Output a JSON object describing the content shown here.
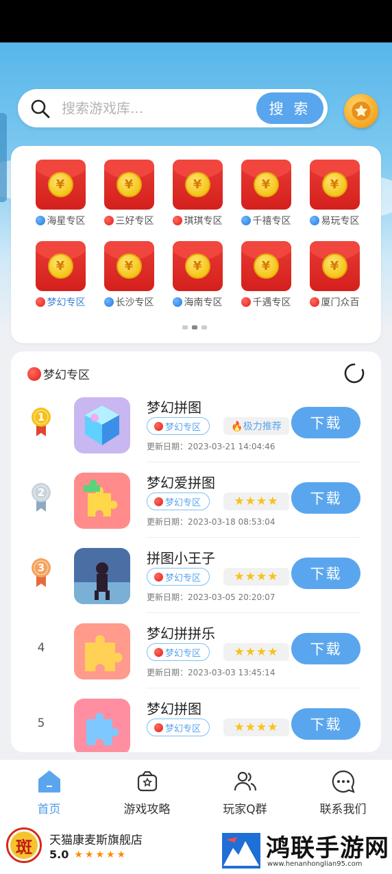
{
  "search": {
    "placeholder": "搜索游戏库...",
    "button_label": "搜 索"
  },
  "zones": [
    {
      "label": "海星专区",
      "dot": "blue",
      "active": false
    },
    {
      "label": "三好专区",
      "dot": "red",
      "active": false
    },
    {
      "label": "琪琪专区",
      "dot": "red",
      "active": false
    },
    {
      "label": "千禧专区",
      "dot": "blue",
      "active": false
    },
    {
      "label": "易玩专区",
      "dot": "blue",
      "active": false
    },
    {
      "label": "梦幻专区",
      "dot": "red",
      "active": true
    },
    {
      "label": "长沙专区",
      "dot": "blue",
      "active": false
    },
    {
      "label": "海南专区",
      "dot": "blue",
      "active": false
    },
    {
      "label": "千遇专区",
      "dot": "red",
      "active": false
    },
    {
      "label": "厦门众百",
      "dot": "red",
      "active": false
    }
  ],
  "coin_symbol": "¥",
  "list": {
    "header": "梦幻专区",
    "games": [
      {
        "rank": "1",
        "title": "梦幻拼图",
        "zone_tag": "梦幻专区",
        "extra_tag": "🔥极力推荐",
        "extra_type": "recommend",
        "update": "更新日期：2023-03-21 14:04:46",
        "button": "下载"
      },
      {
        "rank": "2",
        "title": "梦幻爱拼图",
        "zone_tag": "梦幻专区",
        "extra_tag": "★★★★",
        "extra_type": "stars",
        "update": "更新日期：2023-03-18 08:53:04",
        "button": "下载"
      },
      {
        "rank": "3",
        "title": "拼图小王子",
        "zone_tag": "梦幻专区",
        "extra_tag": "★★★★",
        "extra_type": "stars",
        "update": "更新日期：2023-03-05 20:20:07",
        "button": "下载"
      },
      {
        "rank": "4",
        "title": "梦幻拼拼乐",
        "zone_tag": "梦幻专区",
        "extra_tag": "★★★★",
        "extra_type": "stars",
        "update": "更新日期：2023-03-03 13:45:14",
        "button": "下载"
      },
      {
        "rank": "5",
        "title": "梦幻拼图",
        "zone_tag": "梦幻专区",
        "extra_tag": "★★★★",
        "extra_type": "stars",
        "update": "",
        "button": "下载"
      }
    ]
  },
  "nav": [
    {
      "label": "首页",
      "icon": "home-icon",
      "active": true
    },
    {
      "label": "游戏攻略",
      "icon": "guide-icon",
      "active": false
    },
    {
      "label": "玩家Q群",
      "icon": "group-icon",
      "active": false
    },
    {
      "label": "联系我们",
      "icon": "chat-icon",
      "active": false
    }
  ],
  "ad": {
    "logo_char": "斑",
    "shop_name": "天猫康麦斯旗舰店",
    "rating": "5.0",
    "stars": "★★★★★",
    "brand_name": "鸿联手游网",
    "brand_url": "www.henanhonglian95.com"
  },
  "colors": {
    "accent": "#5aa6ee",
    "red": "#e0201a",
    "gold": "#f5c518"
  }
}
